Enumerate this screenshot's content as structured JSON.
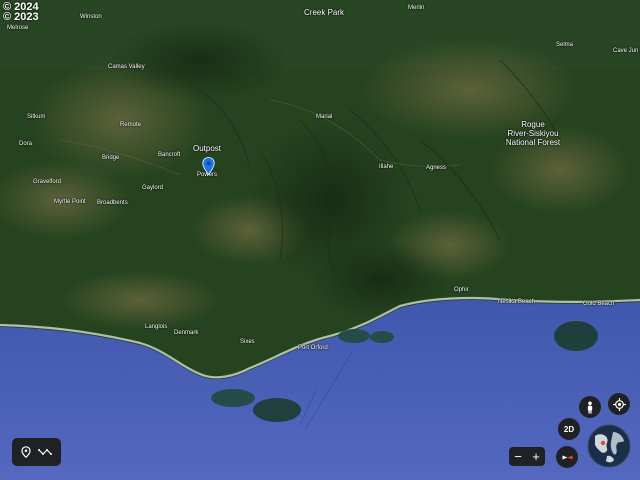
{
  "copyright": [
    "© 2024",
    "© 2023"
  ],
  "places": {
    "winston": "Winston",
    "creek_park": "Creek Park",
    "merlin": "Merlin",
    "melrose": "Melrose",
    "selma": "Selma",
    "cave_junction": "Cave Jun",
    "camas_valley": "Camas Valley",
    "sitkum": "Sitkum",
    "remote": "Remote",
    "marial": "Marial",
    "rogue_forest_1": "Rogue",
    "rogue_forest_2": "River-Siskiyou",
    "rogue_forest_3": "National Forest",
    "dora": "Dora",
    "outpost": "Outpost",
    "bridge": "Bridge",
    "bancroft": "Bancroft",
    "illahe": "Illahe",
    "agness": "Agness",
    "powers": "Powers",
    "gravelford": "Gravelford",
    "gaylord": "Gaylord",
    "myrtle_point": "Myrtle Point",
    "broadbents": "Broadbents",
    "ophir": "Ophir",
    "nesika_beach": "Nesika Beach",
    "gold_beach": "Gold Beach",
    "langlois": "Langlois",
    "denmark": "Denmark",
    "sixes": "Sixes",
    "port_orford": "Port Orford"
  },
  "controls": {
    "mode_2d": "2D",
    "zoom_out": "−",
    "zoom_in": "+"
  },
  "icons": {
    "pin": "location-pin-icon",
    "place": "place-marker-icon",
    "path": "path-measure-icon",
    "pegman": "pegman-icon",
    "my_location": "my-location-icon",
    "compass": "compass-icon",
    "globe": "globe-icon"
  },
  "colors": {
    "forest": "#24421f",
    "ocean": "#4a62b6",
    "control_bg": "#202124",
    "pin": "#1a73e8",
    "compass_red": "#e8453c"
  }
}
